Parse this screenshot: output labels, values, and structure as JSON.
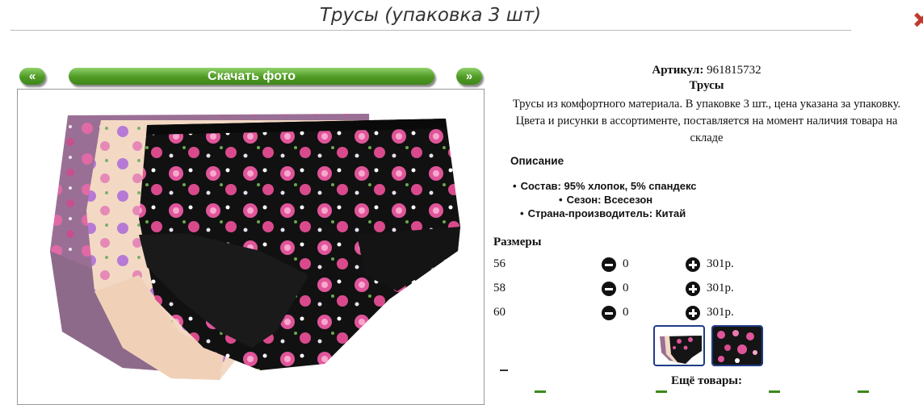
{
  "header": {
    "title": "Трусы (упаковка 3 шт)"
  },
  "gallery": {
    "prev_label": "«",
    "download_label": "Скачать фото",
    "next_label": "»"
  },
  "product": {
    "article_label": "Артикул:",
    "article_value": "961815732",
    "name": "Трусы",
    "description_line1": "Трусы из комфортного материала. В упаковке 3 шт., цена указана за упаковку.",
    "description_line2": "Цвета и рисунки в ассортименте, поставляется на момент наличия товара на",
    "description_line3": "складе",
    "description_heading": "Описание",
    "specs": [
      "Состав: 95% хлопок, 5% спандекс",
      "Сезон: Всесезон",
      "Страна-производитель: Китай"
    ]
  },
  "sizes": {
    "heading": "Размеры",
    "rows": [
      {
        "size": "56",
        "qty": "0",
        "price": "301р."
      },
      {
        "size": "58",
        "qty": "0",
        "price": "301р."
      },
      {
        "size": "60",
        "qty": "0",
        "price": "301р."
      }
    ]
  },
  "more_products_label": "Ещё товары:",
  "colors": {
    "accent_green": "#4f9a24",
    "thumb_border": "#1f3c88",
    "close_red": "#c0392b"
  }
}
